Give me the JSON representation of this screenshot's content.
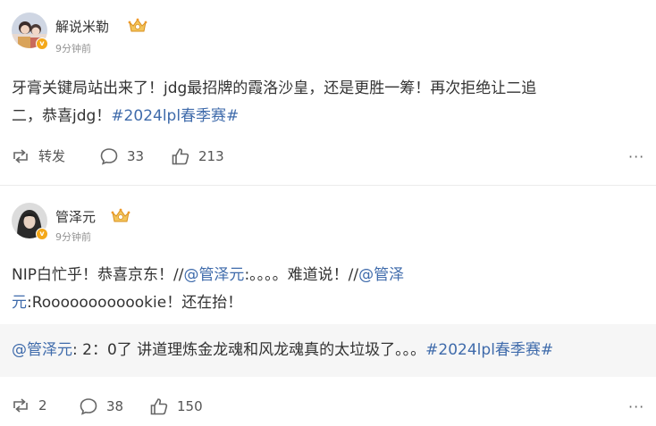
{
  "posts": [
    {
      "author": "解说米勒",
      "time": "9分钟前",
      "content": {
        "line1": "牙膏关键局站出来了！jdg最招牌的霞洛沙皇，还是更胜一筹！再次拒绝让二追",
        "line2_prefix": "二，恭喜jdg！",
        "hashtag": "#2024lpl春季赛#"
      },
      "actions": {
        "repost": "转发",
        "comments": "33",
        "likes": "213"
      }
    },
    {
      "author": "管泽元",
      "time": "9分钟前",
      "content": {
        "text1": "NIP白忙乎！恭喜京东！//",
        "mention1": "@管泽元",
        "text2": ":。。。。难道说！//",
        "mention2a": "@管泽",
        "mention2b": "元",
        "text3": ":Roooooooooookie！还在抬！"
      },
      "quote": {
        "mention": "@管泽元",
        "text": ": 2：0了 讲道理炼金龙魂和风龙魂真的太垃圾了。。。",
        "hashtag": "#2024lpl春季赛#"
      },
      "actions": {
        "reposts": "2",
        "comments": "38",
        "likes": "150"
      }
    }
  ],
  "colors": {
    "link": "#3f6bab",
    "badge": "#f4a81a"
  },
  "icons": [
    "avatar",
    "verified-badge-icon",
    "crown-icon",
    "repost-icon",
    "comment-icon",
    "like-icon",
    "more-icon"
  ]
}
